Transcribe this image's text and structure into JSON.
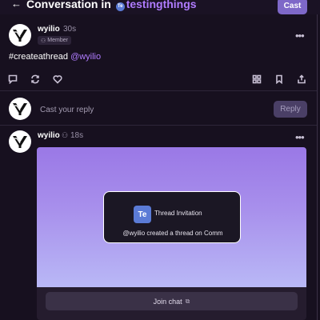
{
  "header": {
    "back_icon": "arrow-left-icon",
    "title_prefix": "Conversation in",
    "channel_badge": "Te",
    "channel_name": "testingthings",
    "cast_label": "Cast"
  },
  "main_post": {
    "username": "wyilio",
    "time": "30s",
    "badge_label": "Member",
    "text_prefix": "#createathread",
    "mention": "@wyilio"
  },
  "actions": {
    "left": [
      "comment-icon",
      "recast-icon",
      "heart-icon"
    ],
    "right": [
      "grid-icon",
      "bookmark-icon",
      "share-icon"
    ]
  },
  "reply": {
    "placeholder": "Cast your reply",
    "button_label": "Reply"
  },
  "reply_post": {
    "username": "wyilio",
    "time": "18s"
  },
  "frame": {
    "logo_text": "Te",
    "title": "Thread Invitation",
    "text": "@wyilio created a thread on Comm",
    "join_label": "Join chat",
    "join_icon": "external-link-icon"
  },
  "colors": {
    "background": "#17101f",
    "accent": "#7e68c8",
    "mention": "#b07cff",
    "channel_badge": "#5b7bd6"
  }
}
